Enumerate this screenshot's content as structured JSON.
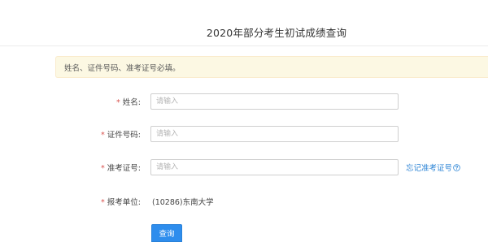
{
  "header": {
    "title": "2020年部分考生初试成绩查询"
  },
  "alert": {
    "message": "姓名、证件号码、准考证号必填。"
  },
  "form": {
    "required_mark": "*",
    "name": {
      "label": "姓名:",
      "placeholder": "请输入",
      "value": ""
    },
    "id_number": {
      "label": "证件号码:",
      "placeholder": "请输入",
      "value": ""
    },
    "admission_number": {
      "label": "准考证号:",
      "placeholder": "请输入",
      "value": "",
      "help_link": "忘记准考证号",
      "help_icon": "question-circle-icon"
    },
    "exam_unit": {
      "label": "报考单位:",
      "value": "(10286)东南大学"
    }
  },
  "actions": {
    "query_label": "查询",
    "accent_color": "#2e8ded",
    "link_color": "#2f86d6",
    "required_color": "#d9534f",
    "alert_background": "#fcf8e3"
  }
}
